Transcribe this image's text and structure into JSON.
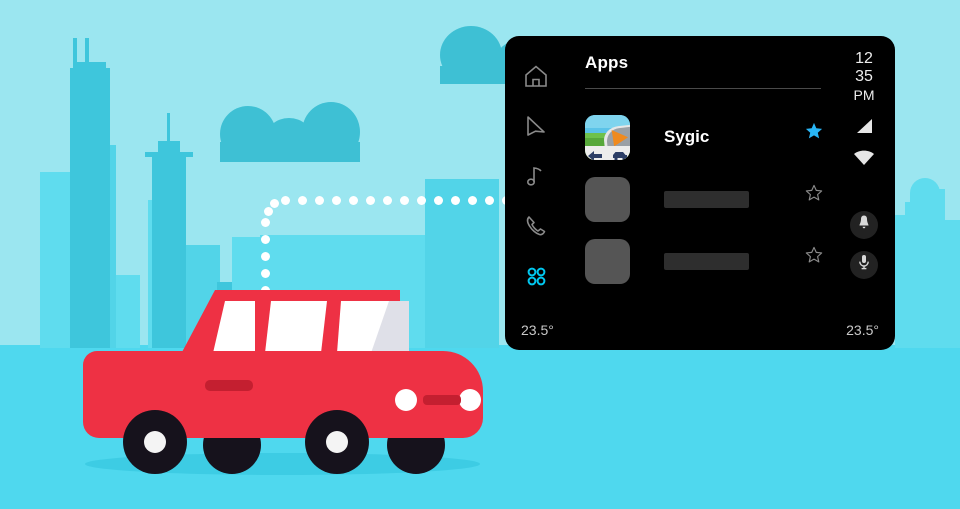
{
  "scene": {
    "background_sky": "#9BE6F0",
    "background_ground": "#4FD8EE",
    "skyline_color": "#5FDCEE",
    "cloud_color": "#3EC0D4",
    "car_color": "#EE3144",
    "route_dot_color": "#FFFFFF"
  },
  "car": {
    "name": "red-station-wagon",
    "body_color": "#EE3144",
    "window_color": "#FFFFFF",
    "wheel_color": "#16121C"
  },
  "head_unit": {
    "background": "#000000",
    "accent": "#29B6F6",
    "header": {
      "title": "Apps"
    },
    "nav_rail": {
      "items": [
        {
          "name": "home-icon",
          "label": "Home",
          "active": false
        },
        {
          "name": "navigation-icon",
          "label": "Navigation",
          "active": false
        },
        {
          "name": "music-icon",
          "label": "Music",
          "active": false
        },
        {
          "name": "phone-icon",
          "label": "Phone",
          "active": false
        },
        {
          "name": "apps-grid-icon",
          "label": "Apps",
          "active": true
        }
      ],
      "active_color": "#00C8F0",
      "inactive_color": "#8A8A8A"
    },
    "app_list": [
      {
        "name": "sygic",
        "label": "Sygic",
        "icon": "sygic-app-icon",
        "favorite": true,
        "star_color": "#29B6F6",
        "placeholder": false
      },
      {
        "name": "app-placeholder-1",
        "label": "",
        "icon": "placeholder-icon",
        "favorite": false,
        "star_color": "#8A8A8A",
        "placeholder": true
      },
      {
        "name": "app-placeholder-2",
        "label": "",
        "icon": "placeholder-icon",
        "favorite": false,
        "star_color": "#8A8A8A",
        "placeholder": true
      }
    ],
    "status": {
      "clock_hours": "12",
      "clock_minutes": "35",
      "clock_ampm": "PM",
      "signal_icon": "cellular-signal-icon",
      "wifi_icon": "wifi-icon",
      "notification_icon": "bell-icon",
      "microphone_icon": "microphone-icon"
    },
    "climate": {
      "left_temp": "23.5°",
      "right_temp": "23.5°"
    }
  }
}
